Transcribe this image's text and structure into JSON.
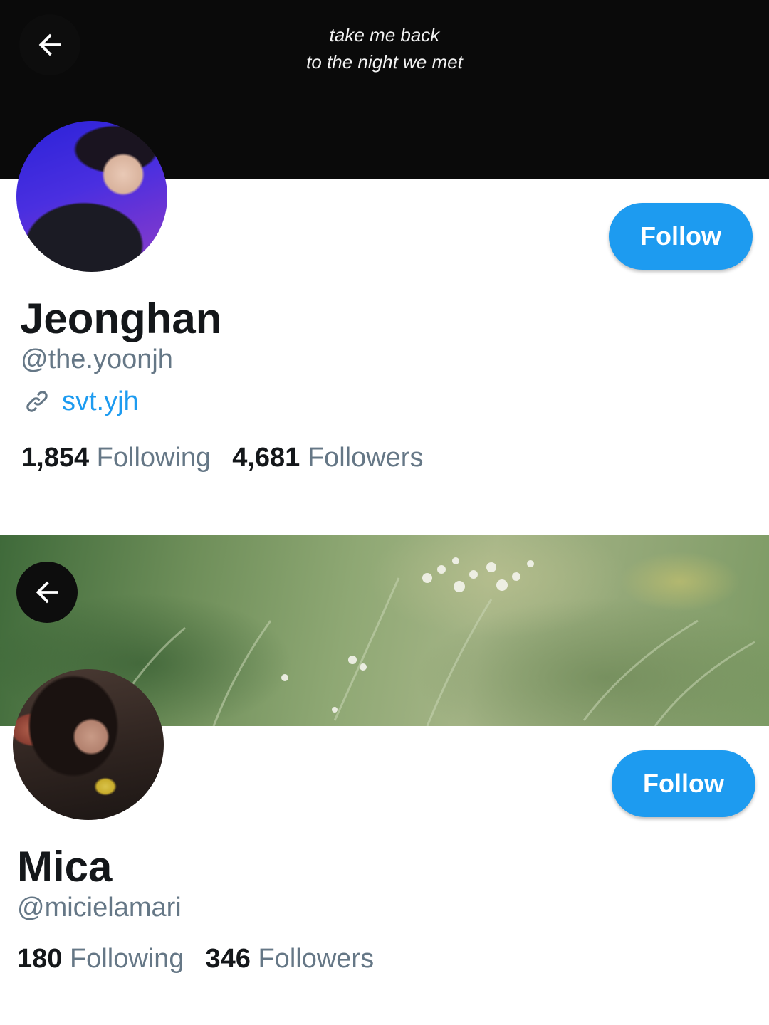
{
  "profiles": [
    {
      "banner_caption": [
        "take me back",
        "to the night we met"
      ],
      "name": "Jeonghan",
      "handle": "@the.yoonjh",
      "link": "svt.yjh",
      "follow_label": "Follow",
      "following_count": "1,854",
      "following_label": "Following",
      "followers_count": "4,681",
      "followers_label": "Followers"
    },
    {
      "name": "Mica",
      "handle": "@micielamari",
      "follow_label": "Follow",
      "following_count": "180",
      "following_label": "Following",
      "followers_count": "346",
      "followers_label": "Followers"
    }
  ],
  "icons": {
    "back": "arrow-left-icon",
    "link": "link-icon"
  },
  "colors": {
    "accent": "#1d9bf0",
    "text_primary": "#14171a",
    "text_secondary": "#657786"
  }
}
